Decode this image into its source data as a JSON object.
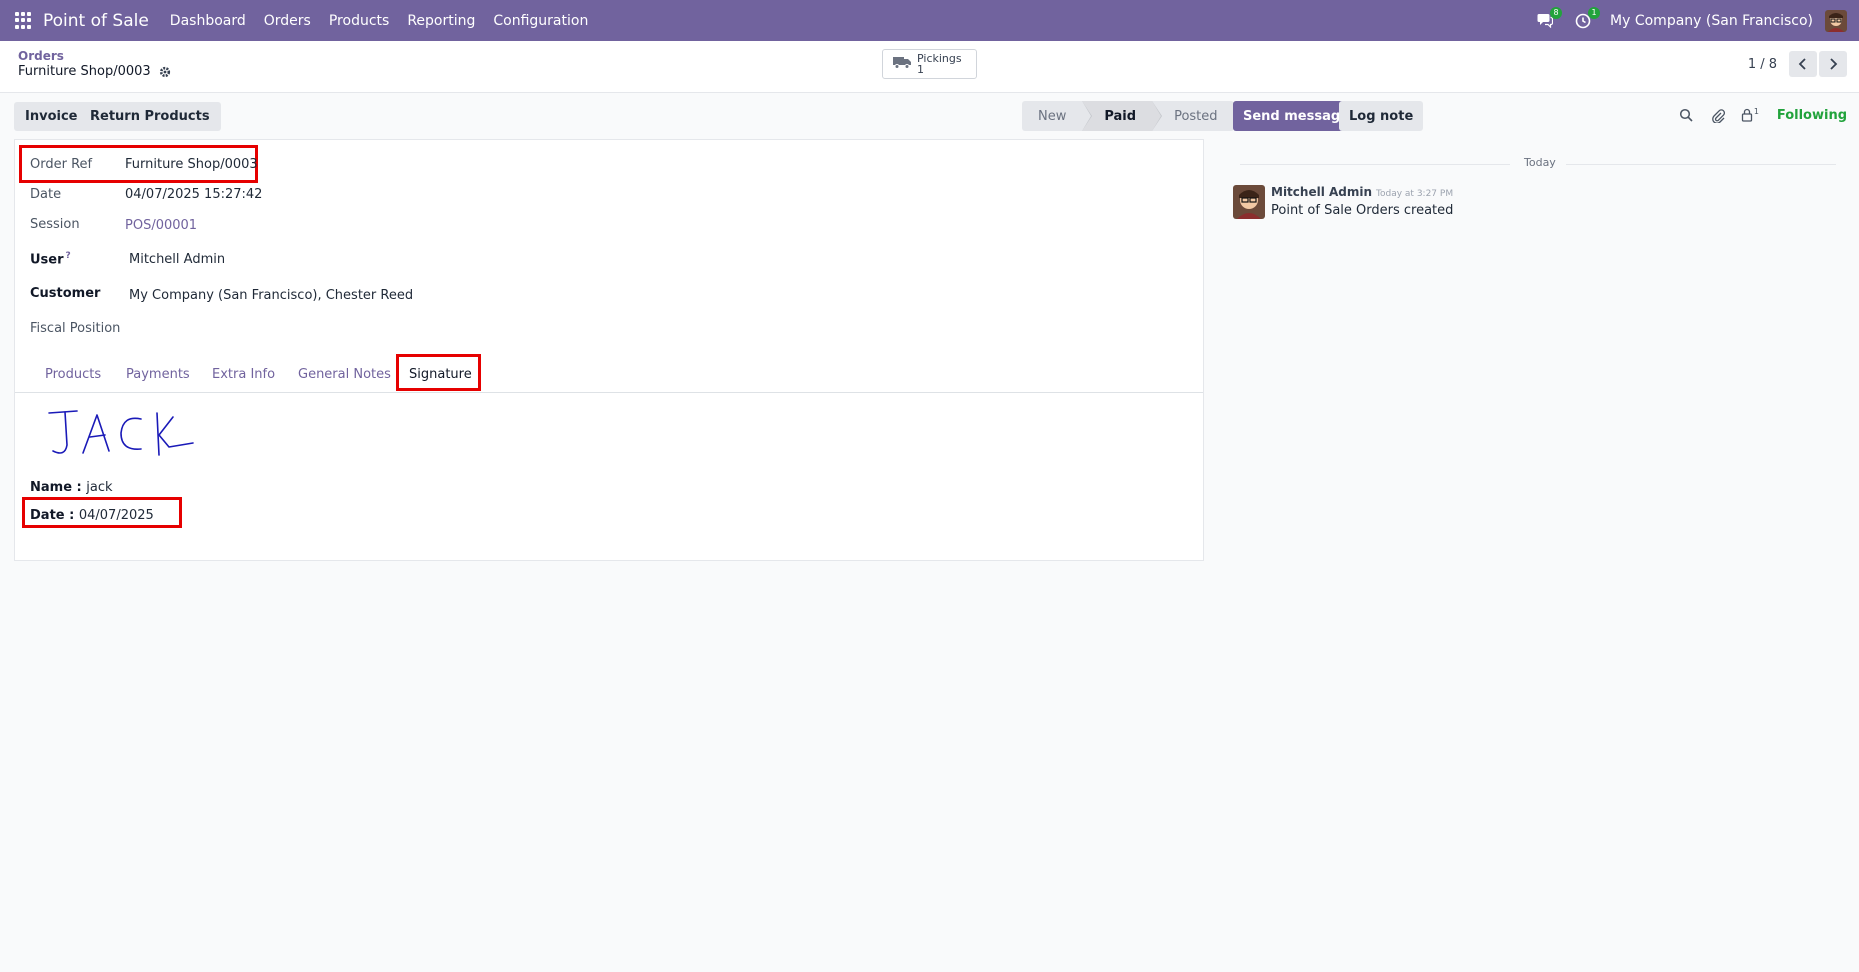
{
  "navbar": {
    "app_title": "Point of Sale",
    "menu": [
      "Dashboard",
      "Orders",
      "Products",
      "Reporting",
      "Configuration"
    ],
    "messages_badge": "8",
    "activities_badge": "1",
    "company": "My Company (San Francisco)",
    "color": "#71639e"
  },
  "control_panel": {
    "breadcrumb_parent": "Orders",
    "breadcrumb_current": "Furniture Shop/0003",
    "smart_button": {
      "label": "Pickings",
      "count": "1"
    },
    "pager": "1 / 8"
  },
  "buttons": {
    "invoice": "Invoice",
    "return_products": "Return Products"
  },
  "statusbar": {
    "stages": [
      "New",
      "Paid",
      "Posted"
    ],
    "active": "Paid"
  },
  "form": {
    "order_ref_label": "Order Ref",
    "order_ref": "Furniture Shop/0003",
    "date_label": "Date",
    "date": "04/07/2025 15:27:42",
    "session_label": "Session",
    "session": "POS/00001",
    "user_label": "User",
    "user_help": "?",
    "user": "Mitchell Admin",
    "customer_label": "Customer",
    "customer": "My Company (San Francisco), Chester Reed",
    "fiscal_position_label": "Fiscal Position"
  },
  "tabs": [
    "Products",
    "Payments",
    "Extra Info",
    "General Notes",
    "Signature"
  ],
  "active_tab": "Signature",
  "signature": {
    "name_label": "Name :",
    "name": "jack",
    "date_label": "Date :",
    "date": "04/07/2025"
  },
  "chatter": {
    "send_message": "Send message",
    "log_note": "Log note",
    "followers_count": "1",
    "following": "Following",
    "separator": "Today",
    "messages": [
      {
        "author": "Mitchell Admin",
        "time": "Today at 3:27 PM",
        "body": "Point of Sale Orders created"
      }
    ]
  },
  "highlight_color": "#e60000"
}
